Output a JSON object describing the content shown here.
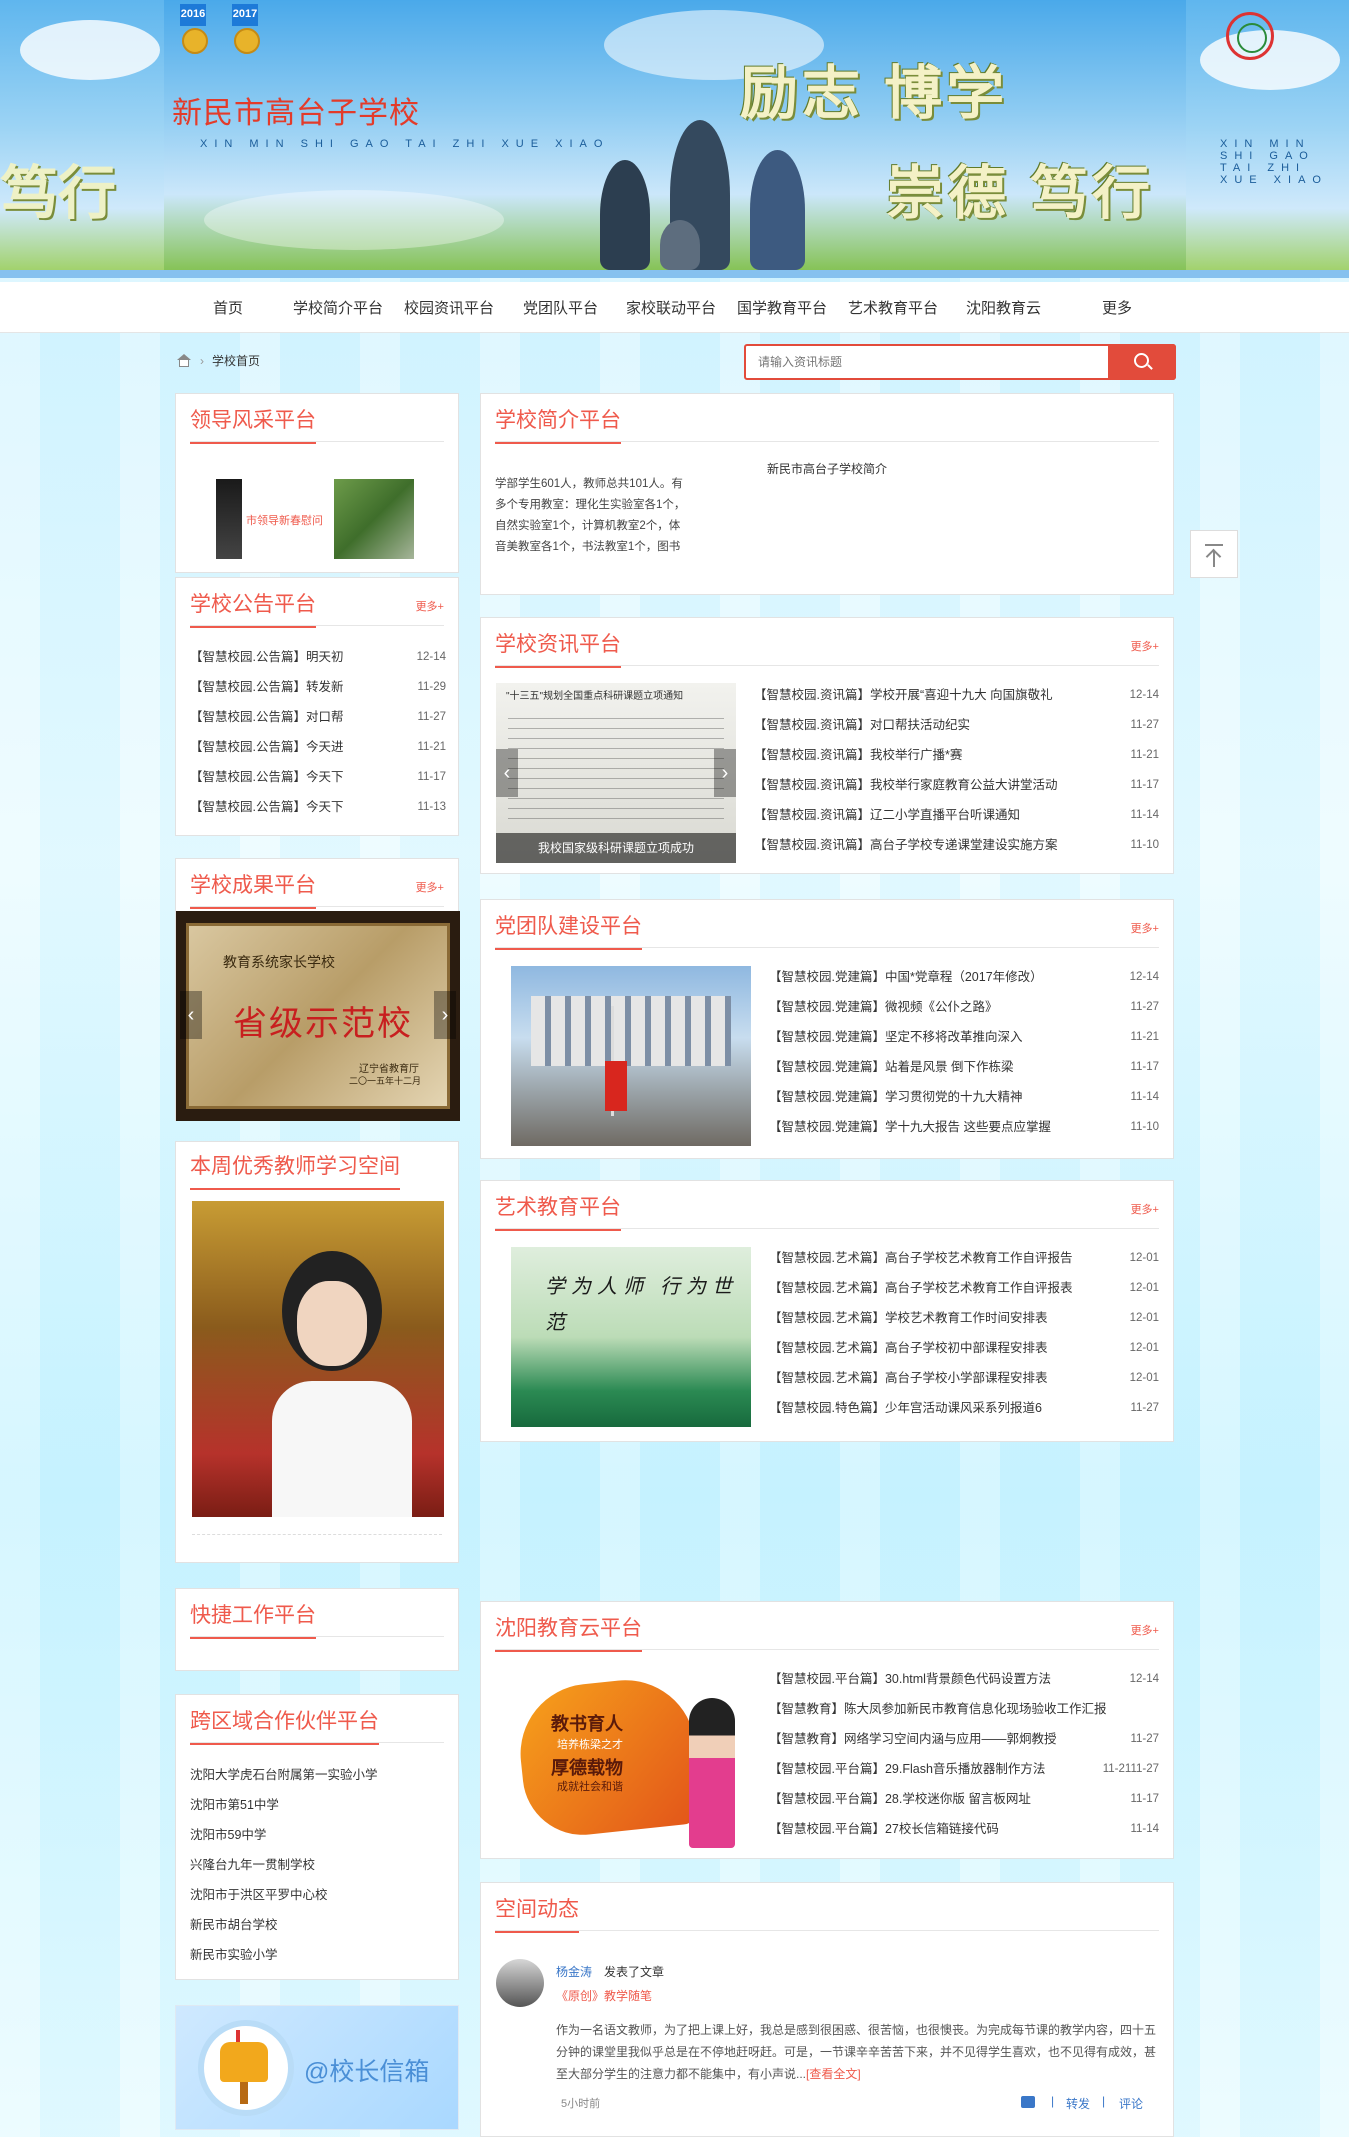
{
  "banner": {
    "school_name": "新民市高台子学校",
    "school_pinyin": "XIN MIN SHI GAO TAI ZHI XUE XIAO",
    "motto_top": "励志 博学",
    "motto_bottom": "崇德 笃行",
    "motto_left": "笃行",
    "medal_years": [
      "2016",
      "2017"
    ]
  },
  "nav": {
    "items": [
      "首页",
      "学校简介平台",
      "校园资讯平台",
      "党团队平台",
      "家校联动平台",
      "国学教育平台",
      "艺术教育平台",
      "沈阳教育云",
      "更多"
    ]
  },
  "breadcrumb": {
    "current": "学校首页"
  },
  "search": {
    "placeholder": "请输入资讯标题"
  },
  "leaders": {
    "title": "领导风采平台",
    "caption": "市领导新春慰问"
  },
  "notices": {
    "title": "学校公告平台",
    "more": "更多+",
    "items": [
      {
        "text": "【智慧校园.公告篇】明天初",
        "date": "12-14"
      },
      {
        "text": "【智慧校园.公告篇】转发新",
        "date": "11-29"
      },
      {
        "text": "【智慧校园.公告篇】对口帮",
        "date": "11-27"
      },
      {
        "text": "【智慧校园.公告篇】今天进",
        "date": "11-21"
      },
      {
        "text": "【智慧校园.公告篇】今天下",
        "date": "11-17"
      },
      {
        "text": "【智慧校园.公告篇】今天下",
        "date": "11-13"
      }
    ]
  },
  "achievements": {
    "title": "学校成果平台",
    "more": "更多+",
    "plaque_top": "教育系统家长学校",
    "plaque_main": "省级示范校",
    "plaque_issuer": "辽宁省教育厅",
    "plaque_date": "二〇一五年十二月"
  },
  "teacher": {
    "title": "本周优秀教师学习空间"
  },
  "quick": {
    "title": "快捷工作平台"
  },
  "partners": {
    "title": "跨区域合作伙伴平台",
    "items": [
      "沈阳大学虎石台附属第一实验小学",
      "沈阳市第51中学",
      "沈阳市59中学",
      "兴隆台九年一贯制学校",
      "沈阳市于洪区平罗中心校",
      "新民市胡台学校",
      "新民市实验小学"
    ]
  },
  "mailbox": {
    "label": "@校长信箱"
  },
  "intro": {
    "title": "学校简介平台",
    "heading": "新民市高台子学校简介",
    "lines": [
      "学部学生601人，教师总共101人。有",
      "多个专用教室：理化生实验室各1个，",
      "自然实验室1个，计算机教室2个，体",
      "音美教室各1个，书法教室1个，图书"
    ]
  },
  "news": {
    "title": "学校资讯平台",
    "more": "更多+",
    "slide_caption": "我校国家级科研课题立项成功",
    "slide_doc_title": "\"十三五\"规划全国重点科研课题立项通知",
    "items": [
      {
        "text": "【智慧校园.资讯篇】学校开展“喜迎十九大 向国旗敬礼",
        "date": "12-14"
      },
      {
        "text": "【智慧校园.资讯篇】对口帮扶活动纪实",
        "date": "11-27"
      },
      {
        "text": "【智慧校园.资讯篇】我校举行广播*赛",
        "date": "11-21"
      },
      {
        "text": "【智慧校园.资讯篇】我校举行家庭教育公益大讲堂活动",
        "date": "11-17"
      },
      {
        "text": "【智慧校园.资讯篇】辽二小学直播平台听课通知",
        "date": "11-14"
      },
      {
        "text": "【智慧校园.资讯篇】高台子学校专递课堂建设实施方案",
        "date": "11-10"
      }
    ]
  },
  "party": {
    "title": "党团队建设平台",
    "more": "更多+",
    "items": [
      {
        "text": "【智慧校园.党建篇】中国*党章程（2017年修改）",
        "date": "12-14"
      },
      {
        "text": "【智慧校园.党建篇】微视频《公仆之路》",
        "date": "11-27"
      },
      {
        "text": "【智慧校园.党建篇】坚定不移将改革推向深入",
        "date": "11-21"
      },
      {
        "text": "【智慧校园.党建篇】站着是风景 倒下作栋梁",
        "date": "11-17"
      },
      {
        "text": "【智慧校园.党建篇】学习贯彻党的十九大精神",
        "date": "11-14"
      },
      {
        "text": "【智慧校园.党建篇】学十九大报告 这些要点应掌握",
        "date": "11-10"
      }
    ]
  },
  "art": {
    "title": "艺术教育平台",
    "more": "更多+",
    "calligraphy": "学为人师 行为世范",
    "items": [
      {
        "text": "【智慧校园.艺术篇】高台子学校艺术教育工作自评报告",
        "date": "12-01"
      },
      {
        "text": "【智慧校园.艺术篇】高台子学校艺术教育工作自评报表",
        "date": "12-01"
      },
      {
        "text": "【智慧校园.艺术篇】学校艺术教育工作时间安排表",
        "date": "12-01"
      },
      {
        "text": "【智慧校园.艺术篇】高台子学校初中部课程安排表",
        "date": "12-01"
      },
      {
        "text": "【智慧校园.艺术篇】高台子学校小学部课程安排表",
        "date": "12-01"
      },
      {
        "text": "【智慧校园.特色篇】少年宫活动课风采系列报道6",
        "date": "11-27"
      }
    ]
  },
  "cloud": {
    "title": "沈阳教育云平台",
    "more": "更多+",
    "poster_line1": "教书育人",
    "poster_line2": "培养栋梁之才",
    "poster_line3": "厚德载物",
    "poster_line4": "成就社会和谐",
    "items": [
      {
        "text": "【智慧校园.平台篇】30.html背景颜色代码设置方法",
        "date": "12-14"
      },
      {
        "text": "【智慧教育】陈大凤参加新民市教育信息化现场验收工作汇报",
        "date": ""
      },
      {
        "text": "【智慧教育】网络学习空间内涵与应用——郭炯教授",
        "date": "11-27"
      },
      {
        "text": "【智慧校园.平台篇】29.Flash音乐播放器制作方法",
        "date": "11-2111-27"
      },
      {
        "text": "【智慧校园.平台篇】28.学校迷你版 留言板网址",
        "date": "11-17"
      },
      {
        "text": "【智慧校园.平台篇】27校长信箱链接代码",
        "date": "11-14"
      }
    ]
  },
  "space": {
    "title": "空间动态",
    "author": "杨金涛",
    "action": "发表了文章",
    "article": "《原创》教学随笔",
    "body": "作为一名语文教师，为了把上课上好，我总是感到很困惑、很苦恼，也很懊丧。为完成每节课的教学内容，四十五分钟的课堂里我似乎总是在不停地赶呀赶。可是，一节课辛辛苦苦下来，并不见得学生喜欢，也不见得有成效，甚至大部分学生的注意力都不能集中，有小声说...",
    "read_more": "[查看全文]",
    "time": "5小时前",
    "share": "转发",
    "comment": "评论"
  },
  "colors": {
    "accent": "#ef5a4c",
    "nav_bg": "#ffffff"
  }
}
